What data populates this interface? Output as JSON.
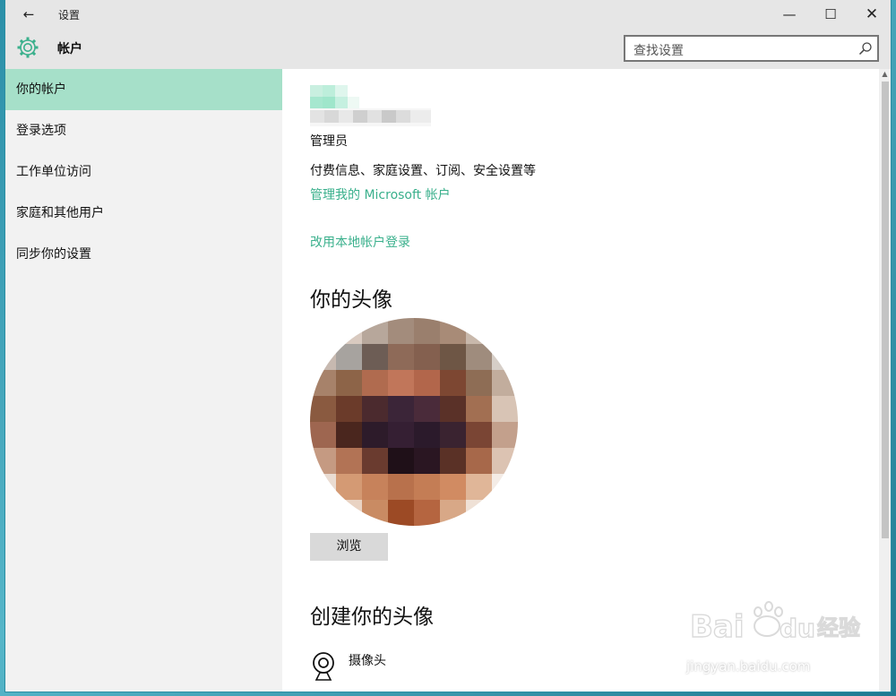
{
  "titlebar": {
    "back_icon": "←",
    "title": "设置",
    "minimize_icon": "—",
    "maximize_icon": "☐",
    "close_icon": "✕"
  },
  "header": {
    "section_title": "帐户",
    "search_placeholder": "查找设置"
  },
  "sidebar": {
    "items": [
      {
        "label": "你的帐户",
        "active": true
      },
      {
        "label": "登录选项",
        "active": false
      },
      {
        "label": "工作单位访问",
        "active": false
      },
      {
        "label": "家庭和其他用户",
        "active": false
      },
      {
        "label": "同步你的设置",
        "active": false
      }
    ]
  },
  "content": {
    "role": "管理员",
    "billing_text": "付费信息、家庭设置、订阅、安全设置等",
    "manage_link": "管理我的 Microsoft 帐户",
    "local_link": "改用本地帐户登录",
    "avatar_heading": "你的头像",
    "browse_button": "浏览",
    "create_heading": "创建你的头像",
    "camera_label": "摄像头"
  },
  "watermark": {
    "text": "jingyan.baidu.com"
  },
  "colors": {
    "accent": "#3ab08c",
    "nav_active": "#a6e0c9",
    "chrome": "#e6e6e6",
    "sidebar": "#f2f2f2"
  }
}
